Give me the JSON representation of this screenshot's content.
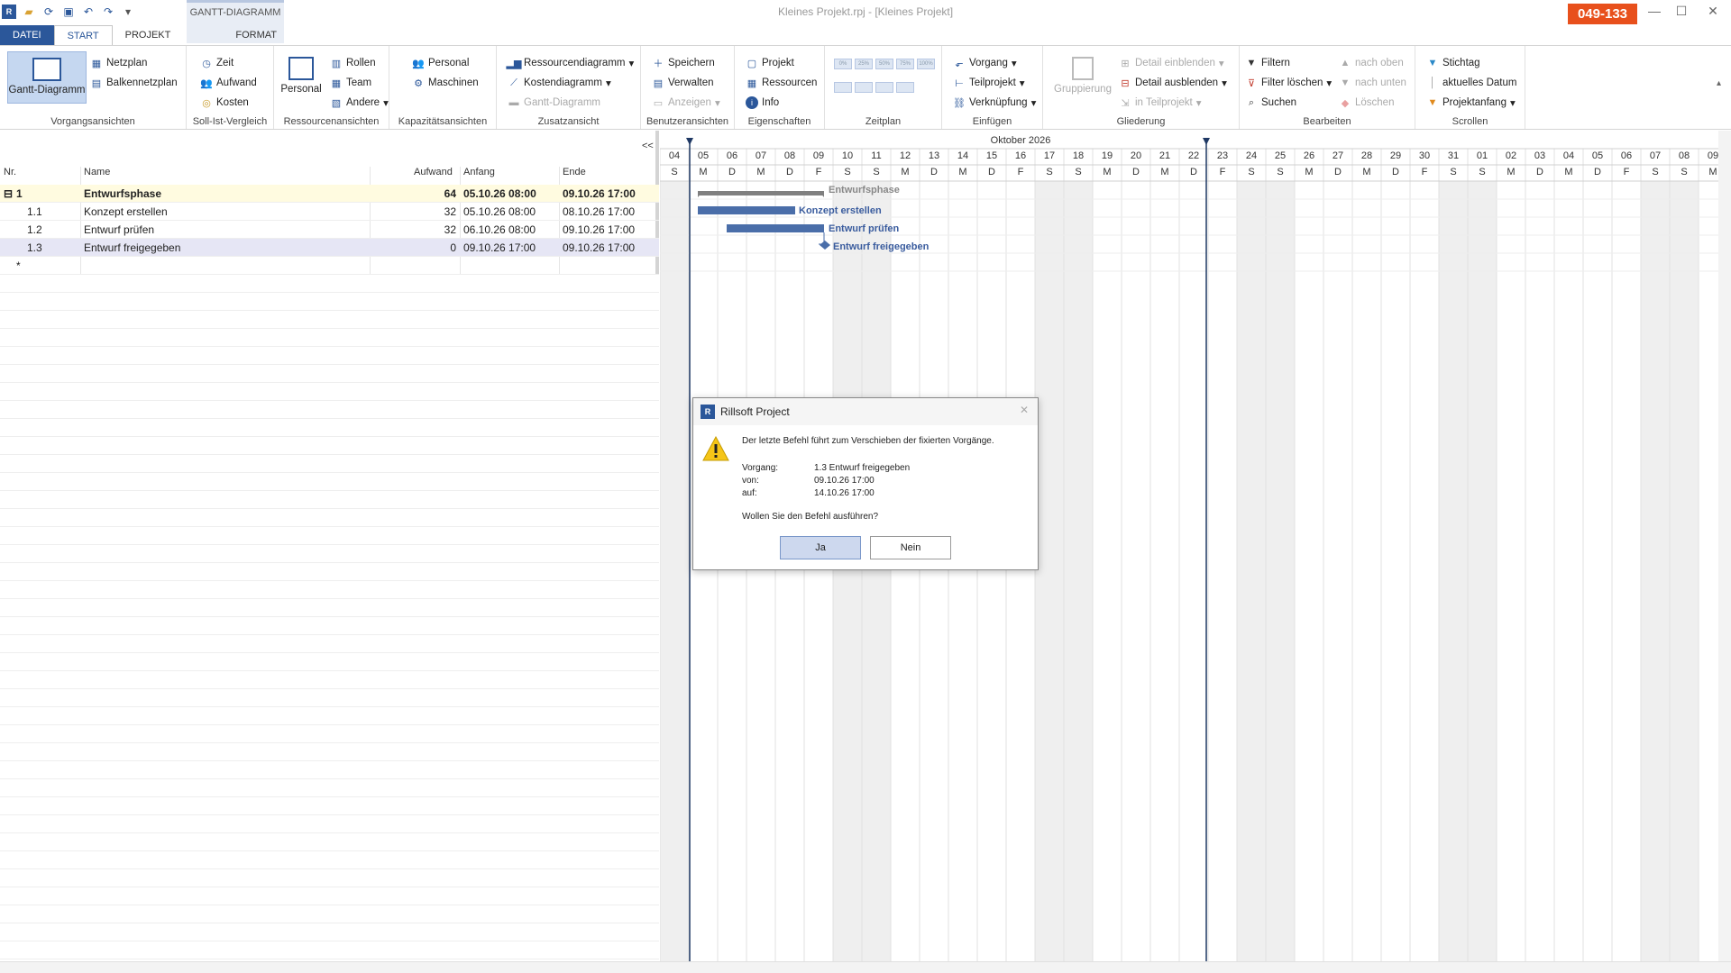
{
  "app": {
    "title": "Kleines Projekt.rpj - [Kleines Projekt]",
    "badge": "049-133",
    "context_tab": "GANTT-DIAGRAMM"
  },
  "tabs": [
    "DATEI",
    "START",
    "PROJEKT",
    "FORMAT"
  ],
  "ribbon": {
    "vorgangsansichten": {
      "label": "Vorgangsansichten",
      "gantt": "Gantt-Diagramm",
      "netzplan": "Netzplan",
      "balken": "Balkennetzplan"
    },
    "sollist": {
      "label": "Soll-Ist-Vergleich",
      "zeit": "Zeit",
      "aufwand": "Aufwand",
      "kosten": "Kosten"
    },
    "ressourcenansichten": {
      "label": "Ressourcenansichten",
      "personal": "Personal",
      "rollen": "Rollen",
      "team": "Team",
      "andere": "Andere"
    },
    "kapazitaet": {
      "label": "Kapazitätsansichten",
      "personal": "Personal",
      "maschinen": "Maschinen"
    },
    "zusatz": {
      "label": "Zusatzansicht",
      "ressdiag": "Ressourcendiagramm",
      "kostendiag": "Kostendiagramm",
      "gantt": "Gantt-Diagramm"
    },
    "benutzer": {
      "label": "Benutzeransichten",
      "speichern": "Speichern",
      "verwalten": "Verwalten",
      "anzeigen": "Anzeigen"
    },
    "eigenschaften": {
      "label": "Eigenschaften",
      "projekt": "Projekt",
      "ressourcen": "Ressourcen",
      "info": "Info"
    },
    "zeitplan": {
      "label": "Zeitplan",
      "zooms": [
        "0%",
        "25%",
        "50%",
        "75%",
        "100%"
      ]
    },
    "einfuegen": {
      "label": "Einfügen",
      "vorgang": "Vorgang",
      "teilprojekt": "Teilprojekt",
      "verknuepfung": "Verknüpfung"
    },
    "gliederung": {
      "label": "Gliederung",
      "gruppierung": "Gruppierung",
      "einblenden": "Detail einblenden",
      "ausblenden": "Detail ausblenden",
      "inteil": "in Teilprojekt"
    },
    "bearbeiten": {
      "label": "Bearbeiten",
      "filtern": "Filtern",
      "filterloeschen": "Filter löschen",
      "suchen": "Suchen",
      "nachoben": "nach oben",
      "nachunten": "nach unten",
      "loeschen": "Löschen"
    },
    "scrollen": {
      "label": "Scrollen",
      "stichtag": "Stichtag",
      "aktuell": "aktuelles Datum",
      "projektanfang": "Projektanfang"
    }
  },
  "table": {
    "collapse": "<<",
    "headers": {
      "nr": "Nr.",
      "name": "Name",
      "aufwand": "Aufwand",
      "anfang": "Anfang",
      "ende": "Ende"
    },
    "rows": [
      {
        "nr": "1",
        "name": "Entwurfsphase",
        "aufwand": "64",
        "anfang": "05.10.26 08:00",
        "ende": "09.10.26 17:00"
      },
      {
        "nr": "1.1",
        "name": "Konzept erstellen",
        "aufwand": "32",
        "anfang": "05.10.26 08:00",
        "ende": "08.10.26 17:00"
      },
      {
        "nr": "1.2",
        "name": "Entwurf prüfen",
        "aufwand": "32",
        "anfang": "06.10.26 08:00",
        "ende": "09.10.26 17:00"
      },
      {
        "nr": "1.3",
        "name": "Entwurf freigegeben",
        "aufwand": "0",
        "anfang": "09.10.26 17:00",
        "ende": "09.10.26 17:00"
      }
    ],
    "new_row_marker": "*"
  },
  "gantt": {
    "month": "Oktober 2026",
    "days": [
      "04",
      "05",
      "06",
      "07",
      "08",
      "09",
      "10",
      "11",
      "12",
      "13",
      "14",
      "15",
      "16",
      "17",
      "18",
      "19",
      "20",
      "21",
      "22",
      "23",
      "24",
      "25",
      "26",
      "27",
      "28",
      "29",
      "30",
      "31",
      "01",
      "02",
      "03",
      "04",
      "05",
      "06",
      "07",
      "08",
      "09"
    ],
    "weekdays": [
      "S",
      "M",
      "D",
      "M",
      "D",
      "F",
      "S",
      "S",
      "M",
      "D",
      "M",
      "D",
      "F",
      "S",
      "S",
      "M",
      "D",
      "M",
      "D",
      "F",
      "S",
      "S",
      "M",
      "D",
      "M",
      "D",
      "F",
      "S",
      "S",
      "M",
      "D",
      "M",
      "D",
      "F",
      "S",
      "S",
      "M"
    ],
    "bar_labels": [
      "Entwurfsphase",
      "Konzept erstellen",
      "Entwurf prüfen",
      "Entwurf freigegeben"
    ],
    "colors": {
      "task": "#4a6ea9",
      "summary": "#7f7f7f",
      "weekend": "#efefef",
      "marker": "#1f3864"
    }
  },
  "dialog": {
    "title": "Rillsoft Project",
    "message": "Der letzte Befehl führt zum Verschieben der fixierten Vorgänge.",
    "vorgang_label": "Vorgang:",
    "vorgang_value": "1.3 Entwurf freigegeben",
    "von_label": "von:",
    "von_value": "09.10.26 17:00",
    "auf_label": "auf:",
    "auf_value": "14.10.26 17:00",
    "question": "Wollen Sie den Befehl ausführen?",
    "yes": "Ja",
    "no": "Nein"
  }
}
